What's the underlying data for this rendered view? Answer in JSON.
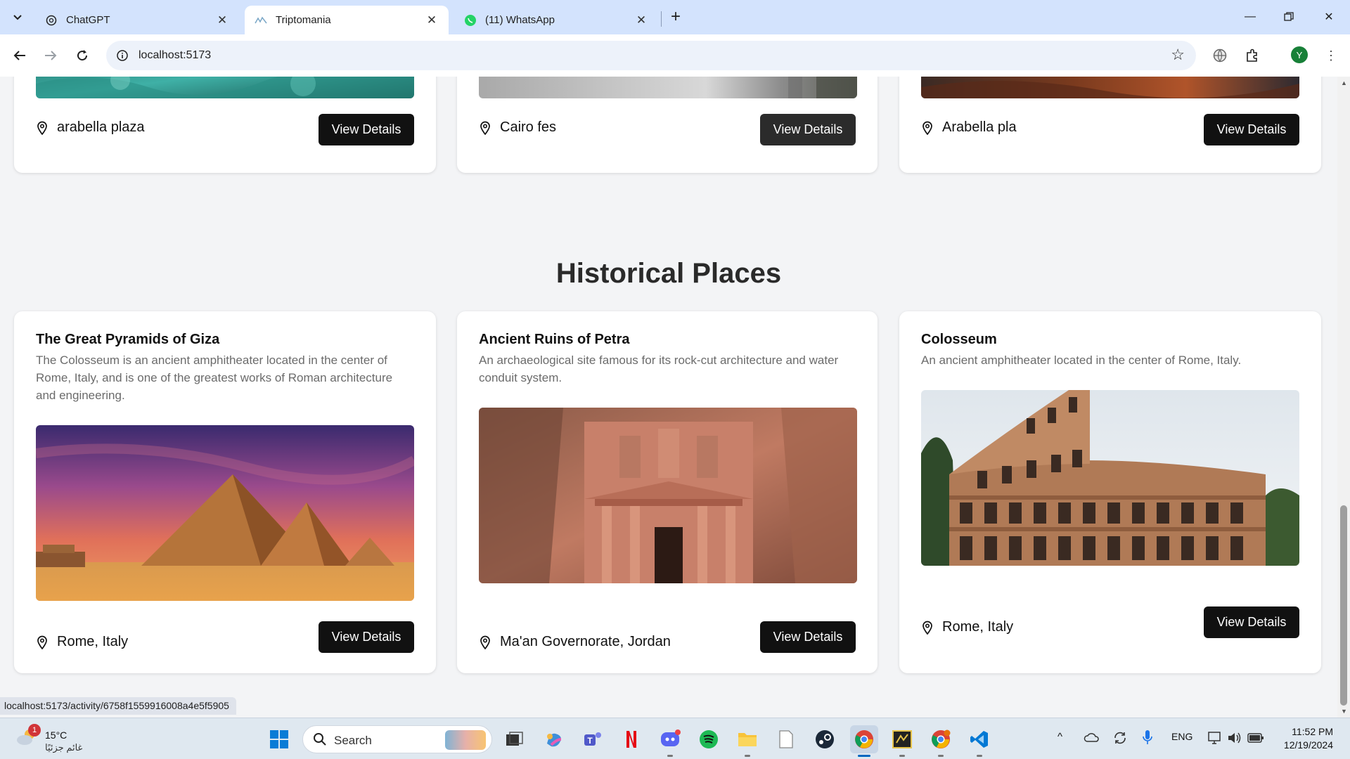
{
  "browser": {
    "tabs": [
      {
        "title": "ChatGPT",
        "icon": "chatgpt-icon",
        "active": false
      },
      {
        "title": "Triptomania",
        "icon": "triptomania-icon",
        "active": true
      },
      {
        "title": "(11) WhatsApp",
        "icon": "whatsapp-icon",
        "active": false
      }
    ],
    "url": "localhost:5173",
    "profile_initial": "Y",
    "status_url": "localhost:5173/activity/6758f1559916008a4e5f5905"
  },
  "top_cards": [
    {
      "location": "arabella plaza",
      "button": "View Details"
    },
    {
      "location": "Cairo fes",
      "button": "View Details"
    },
    {
      "location": "Arabella pla",
      "button": "View Details"
    }
  ],
  "section": {
    "title": "Historical Places"
  },
  "historical_cards": [
    {
      "title": "The Great Pyramids of Giza",
      "description": "The Colosseum is an ancient amphitheater located in the center of Rome, Italy, and is one of the greatest works of Roman architecture and engineering.",
      "location": "Rome, Italy",
      "button": "View Details"
    },
    {
      "title": "Ancient Ruins of Petra",
      "description": "An archaeological site famous for its rock-cut architecture and water conduit system.",
      "location": "Ma'an Governorate, Jordan",
      "button": "View Details"
    },
    {
      "title": "Colosseum",
      "description": "An ancient amphitheater located in the center of Rome, Italy.",
      "location": "Rome, Italy",
      "button": "View Details"
    }
  ],
  "taskbar": {
    "weather_temp": "15°C",
    "weather_condition": "غائم جزئيًا",
    "weather_badge": "1",
    "search_placeholder": "Search",
    "language": "ENG",
    "time": "11:52 PM",
    "date": "12/19/2024"
  },
  "colors": {
    "tabbar": "#d3e3fd",
    "button": "#111111",
    "page_bg": "#f3f4f6"
  }
}
